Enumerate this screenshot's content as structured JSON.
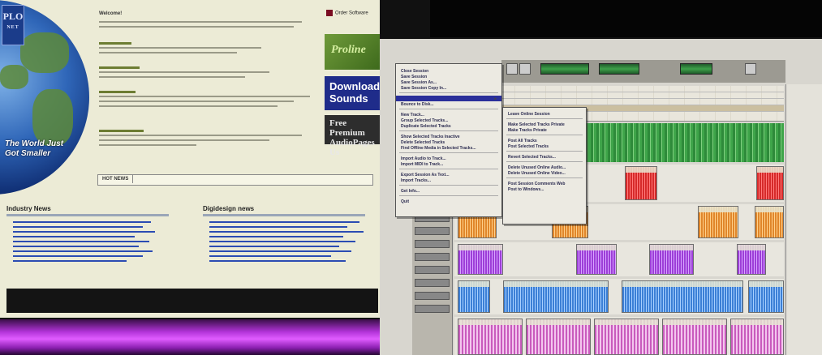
{
  "web": {
    "logo_text": "PLO",
    "logo_sub": "NET",
    "tagline": "The World Just Got Smaller",
    "welcome": "Welcome!",
    "order_button": "Order Software",
    "ad_green": "Proline",
    "ad_download": "Download Sounds",
    "ad_free": "Free Premium AudioPages Us",
    "hot_news_label": "HOT NEWS",
    "industry_news_title": "Industry News",
    "digidesign_news_title": "Digidesign news",
    "colors": {
      "page_bg": "#ecebd6",
      "link": "#2b4cb3",
      "footer_bg": "#141414"
    }
  },
  "app": {
    "file_menu": {
      "items": [
        {
          "label": "Close Session",
          "shortcut": ""
        },
        {
          "label": "Save Session",
          "shortcut": ""
        },
        {
          "label": "Save Session As...",
          "shortcut": ""
        },
        {
          "label": "Save Session Copy In...",
          "shortcut": ""
        },
        {
          "label": "",
          "shortcut": ""
        },
        {
          "label": "Bounce to Disk...",
          "shortcut": ""
        },
        {
          "label": "New Track...",
          "shortcut": ""
        },
        {
          "label": "Group Selected Tracks...",
          "shortcut": ""
        },
        {
          "label": "Duplicate Selected Tracks",
          "shortcut": ""
        },
        {
          "label": "Show Selected Tracks Inactive",
          "shortcut": ""
        },
        {
          "label": "Delete Selected Tracks",
          "shortcut": ""
        },
        {
          "label": "Find Offline Media in Selected Tracks...",
          "shortcut": ""
        },
        {
          "label": "Import Audio to Track...",
          "shortcut": ""
        },
        {
          "label": "Import MIDI to Track...",
          "shortcut": ""
        },
        {
          "label": "Export Session As Text...",
          "shortcut": ""
        },
        {
          "label": "Import Tracks...",
          "shortcut": ""
        },
        {
          "label": "Get Info...",
          "shortcut": ""
        },
        {
          "label": "Quit",
          "shortcut": ""
        }
      ]
    },
    "submenu": {
      "items": [
        "Leave Online Session",
        "Make Selected Tracks Private",
        "Make Tracks Private",
        "Post All Tracks",
        "Post Selected Tracks",
        "Revert Selected Tracks...",
        "Delete Unused Online Audio...",
        "Delete Unused Online Video...",
        "Post Session Comments Web",
        "Post to Windows..."
      ]
    },
    "colors": {
      "green_clip": "#3c9a3c",
      "red_clip": "#d62a2a",
      "orange_clip": "#e0862a",
      "purple_clip": "#9d3ed8",
      "blue_clip": "#3b7fd6",
      "pink_clip": "#d88ad0",
      "menu_highlight": "#2a2f9a"
    }
  }
}
